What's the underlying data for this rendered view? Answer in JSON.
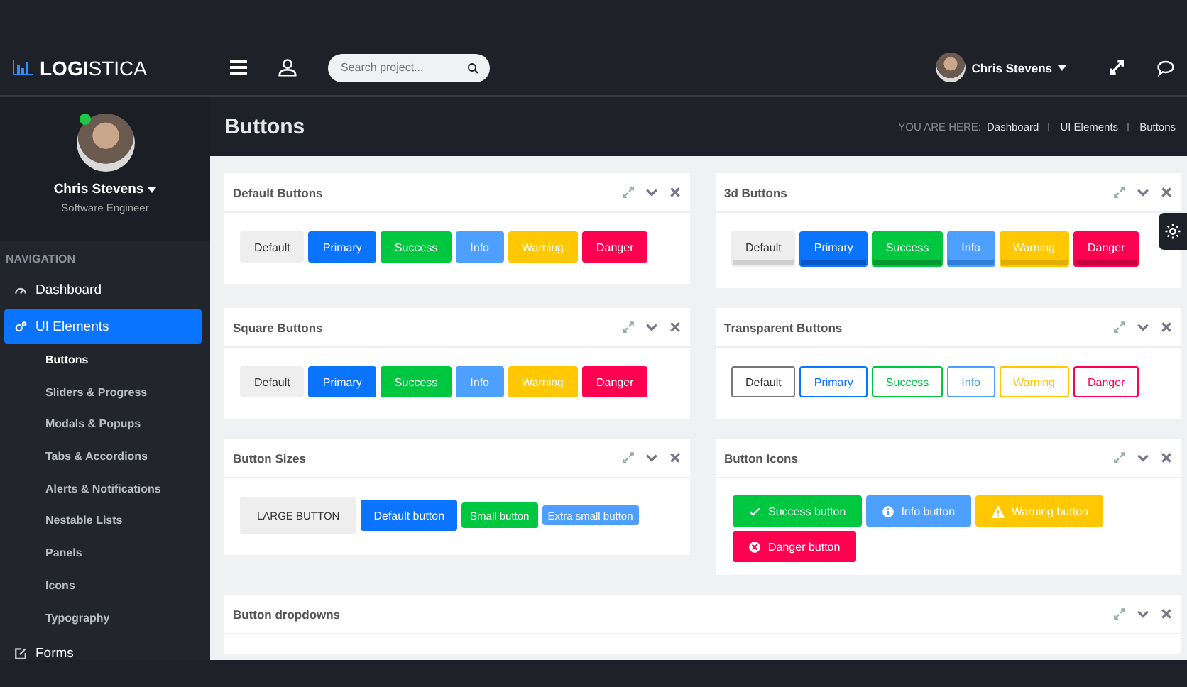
{
  "brand": {
    "bold": "LOGI",
    "light": "STICA"
  },
  "header": {
    "search": {
      "placeholder": "Search project..."
    },
    "user": "Chris Stevens"
  },
  "profile": {
    "name": "Chris Stevens",
    "role": "Software Engineer",
    "online": true
  },
  "nav": {
    "heading": "NAVIGATION",
    "items": [
      {
        "label": "Dashboard",
        "kind": "dashboard",
        "selected": false
      },
      {
        "label": "UI Elements",
        "kind": "elements",
        "selected": true,
        "children": [
          {
            "label": "Buttons",
            "selected": true
          },
          {
            "label": "Sliders & Progress",
            "selected": false
          },
          {
            "label": "Modals & Popups",
            "selected": false
          },
          {
            "label": "Tabs & Accordions",
            "selected": false
          },
          {
            "label": "Alerts & Notifications",
            "selected": false
          },
          {
            "label": "Nestable Lists",
            "selected": false
          },
          {
            "label": "Panels",
            "selected": false
          },
          {
            "label": "Icons",
            "selected": false
          },
          {
            "label": "Typography",
            "selected": false
          }
        ]
      },
      {
        "label": "Forms",
        "kind": "forms",
        "selected": false
      }
    ]
  },
  "page": {
    "title": "Buttons",
    "breadcrumb_prefix": "YOU ARE HERE:",
    "breadcrumb": [
      "Dashboard",
      "UI Elements",
      "Buttons"
    ]
  },
  "panels": [
    {
      "title": "Default Buttons",
      "kind": "flat",
      "buttons": [
        {
          "label": "Default",
          "kind": "default"
        },
        {
          "label": "Primary",
          "kind": "primary"
        },
        {
          "label": "Success",
          "kind": "success"
        },
        {
          "label": "Info",
          "kind": "info"
        },
        {
          "label": "Warning",
          "kind": "warning"
        },
        {
          "label": "Danger",
          "kind": "danger"
        }
      ]
    },
    {
      "title": "3d Buttons",
      "kind": "raised",
      "buttons": [
        {
          "label": "Default",
          "kind": "default"
        },
        {
          "label": "Primary",
          "kind": "primary"
        },
        {
          "label": "Success",
          "kind": "success"
        },
        {
          "label": "Info",
          "kind": "info"
        },
        {
          "label": "Warning",
          "kind": "warning"
        },
        {
          "label": "Danger",
          "kind": "danger"
        }
      ]
    },
    {
      "title": "Square Buttons",
      "kind": "flat",
      "buttons": [
        {
          "label": "Default",
          "kind": "default"
        },
        {
          "label": "Primary",
          "kind": "primary"
        },
        {
          "label": "Success",
          "kind": "success"
        },
        {
          "label": "Info",
          "kind": "info"
        },
        {
          "label": "Warning",
          "kind": "warning"
        },
        {
          "label": "Danger",
          "kind": "danger"
        }
      ]
    },
    {
      "title": "Transparent Buttons",
      "kind": "outline",
      "buttons": [
        {
          "label": "Default",
          "kind": "default"
        },
        {
          "label": "Primary",
          "kind": "primary"
        },
        {
          "label": "Success",
          "kind": "success"
        },
        {
          "label": "Info",
          "kind": "info"
        },
        {
          "label": "Warning",
          "kind": "warning"
        },
        {
          "label": "Danger",
          "kind": "danger"
        }
      ]
    },
    {
      "title": "Button Sizes",
      "kind": "sizes",
      "buttons": [
        {
          "label": "LARGE BUTTON",
          "kind": "default"
        },
        {
          "label": "Default button",
          "kind": "primary"
        },
        {
          "label": "Small button",
          "kind": "success"
        },
        {
          "label": "Extra small button",
          "kind": "info"
        }
      ]
    },
    {
      "title": "Button Icons",
      "kind": "icons",
      "buttons": [
        {
          "label": "Success button",
          "kind": "success"
        },
        {
          "label": "Info button",
          "kind": "info"
        },
        {
          "label": "Warning button",
          "kind": "warning"
        },
        {
          "label": "Danger button",
          "kind": "danger"
        }
      ]
    },
    {
      "title": "Button dropdowns",
      "kind": "dropdowns"
    }
  ]
}
